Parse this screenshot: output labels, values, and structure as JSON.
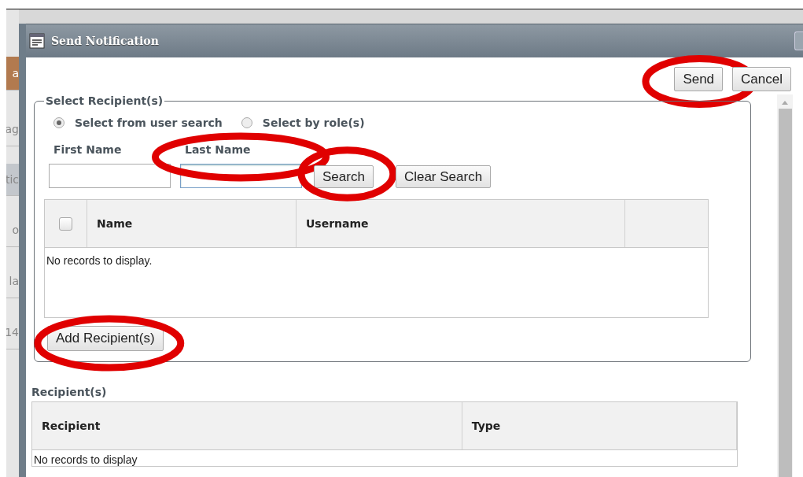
{
  "background_sidebar": {
    "items": [
      {
        "label": "a",
        "kind": "active"
      },
      {
        "label": "ag",
        "kind": "plain"
      },
      {
        "label": "tic",
        "kind": "group"
      },
      {
        "label": "o",
        "kind": "plain"
      },
      {
        "label": "la",
        "kind": "plain"
      },
      {
        "label": "14",
        "kind": "plain"
      }
    ]
  },
  "dialog": {
    "title": "Send Notification",
    "buttons": [
      {
        "label": "Send",
        "circled": true
      },
      {
        "label": "Cancel",
        "circled": false
      }
    ],
    "recipient_search": {
      "legend": "Select Recipient(s)",
      "modes": [
        {
          "label": "Select from user search",
          "selected": true
        },
        {
          "label": "Select by role(s)",
          "selected": false
        }
      ],
      "first_name": {
        "label": "First Name",
        "circled": false,
        "focused": false
      },
      "last_name": {
        "label": "Last Name",
        "circled": true,
        "focused": true
      },
      "search_button": {
        "label": "Search",
        "circled": true
      },
      "clear_button": {
        "label": "Clear Search",
        "circled": false
      },
      "results": {
        "select_all_checked": false,
        "columns": [
          "Name",
          "Username"
        ],
        "empty_message": "No records to display."
      },
      "add_button": {
        "label": "Add Recipient(s)",
        "circled": true
      }
    },
    "recipients": {
      "title": "Recipient(s)",
      "columns": [
        "Recipient",
        "Type"
      ],
      "empty_message": "No records to display"
    }
  }
}
